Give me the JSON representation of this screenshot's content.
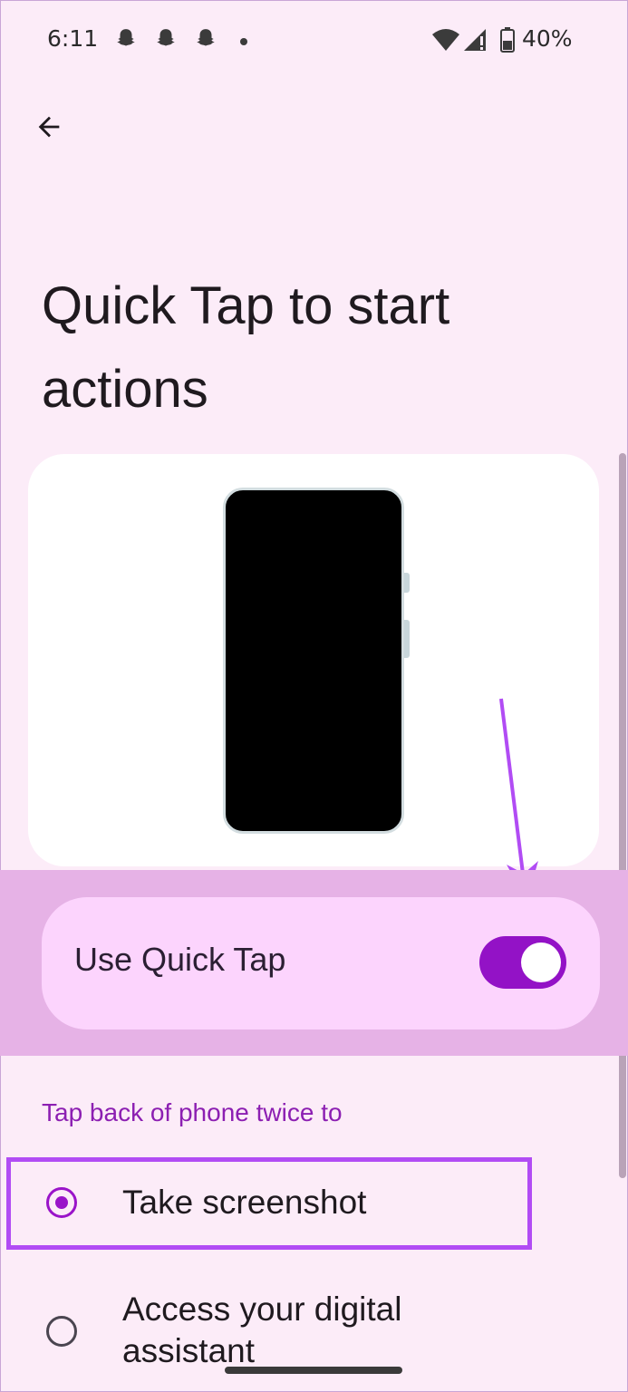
{
  "status_bar": {
    "time": "6:11",
    "battery": "40%"
  },
  "page": {
    "title": "Quick Tap to start actions"
  },
  "main_toggle": {
    "label": "Use Quick Tap",
    "enabled": true
  },
  "section": {
    "header": "Tap back of phone twice to"
  },
  "options": [
    {
      "label": "Take screenshot",
      "selected": true
    },
    {
      "label": "Access your digital assistant",
      "selected": false
    }
  ],
  "colors": {
    "accent": "#9312c6",
    "background": "#fcecf8",
    "annotation": "#b14cf4"
  }
}
